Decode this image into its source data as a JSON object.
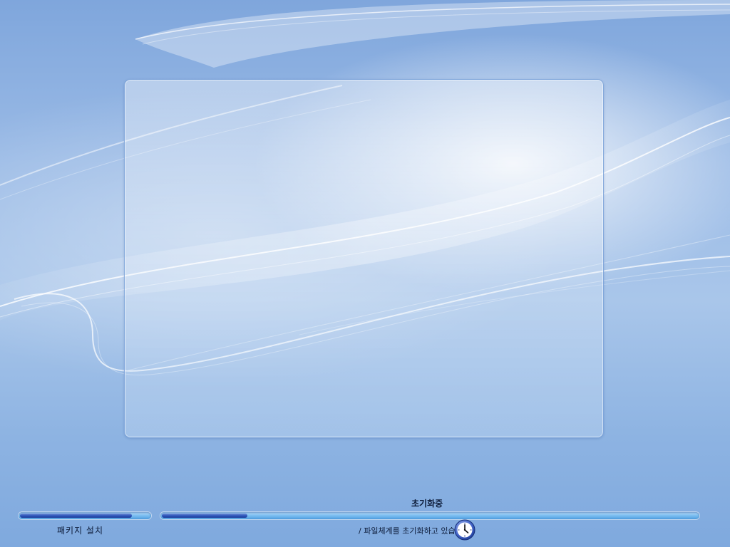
{
  "installer": {
    "package_label": "패키지 설치",
    "stage_title": "초기화중",
    "status_text": "/ 파일체계를 초기화하고 있습니다.",
    "package_progress": 0.86,
    "overall_progress": 0.16
  },
  "icons": {
    "busy_cursor": "clock-icon"
  },
  "colors": {
    "background": "#9bbbe6",
    "progress_fill": "#2a52b8",
    "progress_track": "#7fc0f1",
    "text": "#0d1c3a"
  }
}
